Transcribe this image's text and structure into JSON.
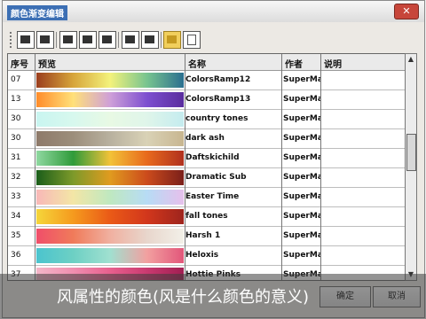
{
  "window": {
    "title": "颜色渐变编辑"
  },
  "toolbar": {
    "buttons": [
      "import-icon",
      "export-icon",
      "copy-icon",
      "grid-icon",
      "palette-icon",
      "convert-icon",
      "apply-icon",
      "open-folder-icon",
      "new-icon"
    ]
  },
  "table": {
    "headers": {
      "id": "序号",
      "preview": "预览",
      "name": "名称",
      "author": "作者",
      "extra": "说明"
    },
    "rows": [
      {
        "id": "07",
        "name": "ColorsRamp12",
        "author": "SuperMap",
        "extra": "",
        "colors": [
          "#9b3e1e",
          "#d7a53a",
          "#f3f27b",
          "#78c48f",
          "#2a6f8f"
        ]
      },
      {
        "id": "13",
        "name": "ColorsRamp13",
        "author": "SuperMap",
        "extra": "",
        "colors": [
          "#ff8c2a",
          "#ffe07a",
          "#cfa0d8",
          "#7d4fd0",
          "#5a2d9e"
        ]
      },
      {
        "id": "30",
        "name": "country tones",
        "author": "SuperMap",
        "extra": "",
        "colors": [
          "#c9f5f0",
          "#d7f8ee",
          "#e8f9e4",
          "#dff5ea",
          "#c4ecef"
        ]
      },
      {
        "id": "30",
        "name": "dark ash",
        "author": "SuperMap",
        "extra": "",
        "colors": [
          "#8e7a6a",
          "#9c8e7b",
          "#b8b19f",
          "#d9d2b6",
          "#c8b690"
        ]
      },
      {
        "id": "31",
        "name": "Daftskichild",
        "author": "SuperMap",
        "extra": "",
        "colors": [
          "#8fd8a0",
          "#2f9b3a",
          "#f2c238",
          "#e86a1d",
          "#b0301e"
        ]
      },
      {
        "id": "32",
        "name": "Dramatic Sub",
        "author": "SuperMap",
        "extra": "",
        "colors": [
          "#1a5d1a",
          "#7d9a2a",
          "#e09b1f",
          "#cc4b1c",
          "#7a1f1a"
        ]
      },
      {
        "id": "33",
        "name": "Easter Time",
        "author": "SuperMap",
        "extra": "",
        "colors": [
          "#f8b8b8",
          "#f3e6a6",
          "#bfe8c0",
          "#b7dcf5",
          "#e6c0ec"
        ]
      },
      {
        "id": "34",
        "name": "fall tones",
        "author": "SuperMap",
        "extra": "",
        "colors": [
          "#f5d63a",
          "#f59a1e",
          "#ea5a17",
          "#d2371c",
          "#9e241d"
        ]
      },
      {
        "id": "35",
        "name": "Harsh 1",
        "author": "SuperMap",
        "extra": "",
        "colors": [
          "#f04e6a",
          "#f07b5a",
          "#f0b0a0",
          "#e8d6cc",
          "#f2f0e8"
        ]
      },
      {
        "id": "36",
        "name": "Heloxis",
        "author": "SuperMap",
        "extra": "",
        "colors": [
          "#4bc4ce",
          "#6dd0c4",
          "#a0e0d0",
          "#f2a0a0",
          "#e2567a"
        ]
      },
      {
        "id": "37",
        "name": "Hottie Pinks",
        "author": "SuperMap",
        "extra": "",
        "colors": [
          "#f4b6c8",
          "#f08eb0",
          "#e8608e",
          "#c93a70",
          "#a11e52"
        ]
      }
    ]
  },
  "footer": {
    "ok_label": "确定",
    "cancel_label": "取消"
  },
  "overlay": {
    "caption": "风属性的颜色(风是什么颜色的意义)"
  }
}
